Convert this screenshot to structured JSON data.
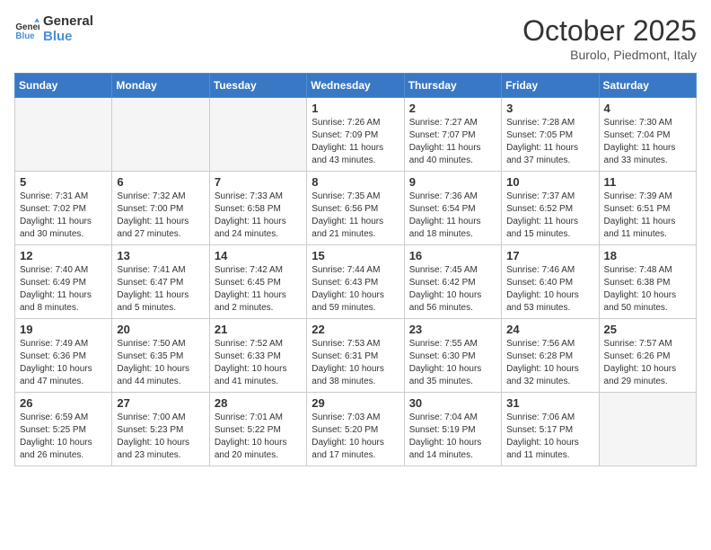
{
  "header": {
    "logo_line1": "General",
    "logo_line2": "Blue",
    "month": "October 2025",
    "location": "Burolo, Piedmont, Italy"
  },
  "days_of_week": [
    "Sunday",
    "Monday",
    "Tuesday",
    "Wednesday",
    "Thursday",
    "Friday",
    "Saturday"
  ],
  "weeks": [
    [
      {
        "day": "",
        "info": ""
      },
      {
        "day": "",
        "info": ""
      },
      {
        "day": "",
        "info": ""
      },
      {
        "day": "1",
        "info": "Sunrise: 7:26 AM\nSunset: 7:09 PM\nDaylight: 11 hours\nand 43 minutes."
      },
      {
        "day": "2",
        "info": "Sunrise: 7:27 AM\nSunset: 7:07 PM\nDaylight: 11 hours\nand 40 minutes."
      },
      {
        "day": "3",
        "info": "Sunrise: 7:28 AM\nSunset: 7:05 PM\nDaylight: 11 hours\nand 37 minutes."
      },
      {
        "day": "4",
        "info": "Sunrise: 7:30 AM\nSunset: 7:04 PM\nDaylight: 11 hours\nand 33 minutes."
      }
    ],
    [
      {
        "day": "5",
        "info": "Sunrise: 7:31 AM\nSunset: 7:02 PM\nDaylight: 11 hours\nand 30 minutes."
      },
      {
        "day": "6",
        "info": "Sunrise: 7:32 AM\nSunset: 7:00 PM\nDaylight: 11 hours\nand 27 minutes."
      },
      {
        "day": "7",
        "info": "Sunrise: 7:33 AM\nSunset: 6:58 PM\nDaylight: 11 hours\nand 24 minutes."
      },
      {
        "day": "8",
        "info": "Sunrise: 7:35 AM\nSunset: 6:56 PM\nDaylight: 11 hours\nand 21 minutes."
      },
      {
        "day": "9",
        "info": "Sunrise: 7:36 AM\nSunset: 6:54 PM\nDaylight: 11 hours\nand 18 minutes."
      },
      {
        "day": "10",
        "info": "Sunrise: 7:37 AM\nSunset: 6:52 PM\nDaylight: 11 hours\nand 15 minutes."
      },
      {
        "day": "11",
        "info": "Sunrise: 7:39 AM\nSunset: 6:51 PM\nDaylight: 11 hours\nand 11 minutes."
      }
    ],
    [
      {
        "day": "12",
        "info": "Sunrise: 7:40 AM\nSunset: 6:49 PM\nDaylight: 11 hours\nand 8 minutes."
      },
      {
        "day": "13",
        "info": "Sunrise: 7:41 AM\nSunset: 6:47 PM\nDaylight: 11 hours\nand 5 minutes."
      },
      {
        "day": "14",
        "info": "Sunrise: 7:42 AM\nSunset: 6:45 PM\nDaylight: 11 hours\nand 2 minutes."
      },
      {
        "day": "15",
        "info": "Sunrise: 7:44 AM\nSunset: 6:43 PM\nDaylight: 10 hours\nand 59 minutes."
      },
      {
        "day": "16",
        "info": "Sunrise: 7:45 AM\nSunset: 6:42 PM\nDaylight: 10 hours\nand 56 minutes."
      },
      {
        "day": "17",
        "info": "Sunrise: 7:46 AM\nSunset: 6:40 PM\nDaylight: 10 hours\nand 53 minutes."
      },
      {
        "day": "18",
        "info": "Sunrise: 7:48 AM\nSunset: 6:38 PM\nDaylight: 10 hours\nand 50 minutes."
      }
    ],
    [
      {
        "day": "19",
        "info": "Sunrise: 7:49 AM\nSunset: 6:36 PM\nDaylight: 10 hours\nand 47 minutes."
      },
      {
        "day": "20",
        "info": "Sunrise: 7:50 AM\nSunset: 6:35 PM\nDaylight: 10 hours\nand 44 minutes."
      },
      {
        "day": "21",
        "info": "Sunrise: 7:52 AM\nSunset: 6:33 PM\nDaylight: 10 hours\nand 41 minutes."
      },
      {
        "day": "22",
        "info": "Sunrise: 7:53 AM\nSunset: 6:31 PM\nDaylight: 10 hours\nand 38 minutes."
      },
      {
        "day": "23",
        "info": "Sunrise: 7:55 AM\nSunset: 6:30 PM\nDaylight: 10 hours\nand 35 minutes."
      },
      {
        "day": "24",
        "info": "Sunrise: 7:56 AM\nSunset: 6:28 PM\nDaylight: 10 hours\nand 32 minutes."
      },
      {
        "day": "25",
        "info": "Sunrise: 7:57 AM\nSunset: 6:26 PM\nDaylight: 10 hours\nand 29 minutes."
      }
    ],
    [
      {
        "day": "26",
        "info": "Sunrise: 6:59 AM\nSunset: 5:25 PM\nDaylight: 10 hours\nand 26 minutes."
      },
      {
        "day": "27",
        "info": "Sunrise: 7:00 AM\nSunset: 5:23 PM\nDaylight: 10 hours\nand 23 minutes."
      },
      {
        "day": "28",
        "info": "Sunrise: 7:01 AM\nSunset: 5:22 PM\nDaylight: 10 hours\nand 20 minutes."
      },
      {
        "day": "29",
        "info": "Sunrise: 7:03 AM\nSunset: 5:20 PM\nDaylight: 10 hours\nand 17 minutes."
      },
      {
        "day": "30",
        "info": "Sunrise: 7:04 AM\nSunset: 5:19 PM\nDaylight: 10 hours\nand 14 minutes."
      },
      {
        "day": "31",
        "info": "Sunrise: 7:06 AM\nSunset: 5:17 PM\nDaylight: 10 hours\nand 11 minutes."
      },
      {
        "day": "",
        "info": ""
      }
    ]
  ]
}
